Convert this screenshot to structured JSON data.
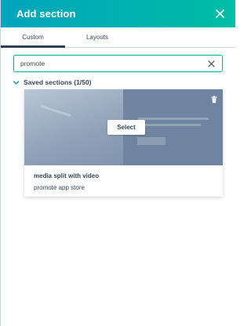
{
  "panel": {
    "title": "Add section"
  },
  "tabs": [
    {
      "label": "Custom",
      "active": true
    },
    {
      "label": "Layouts",
      "active": false
    }
  ],
  "search": {
    "value": "promote",
    "placeholder": ""
  },
  "group": {
    "label": "Saved sections (1/50)",
    "expanded": true
  },
  "card": {
    "title": "media split with video",
    "description": "promote app store",
    "select_label": "Select"
  },
  "icons": {
    "close": "close-icon",
    "clear": "clear-icon",
    "chevron": "chevron-down-icon",
    "delete": "trash-icon"
  },
  "colors": {
    "header_start": "#00a4bd",
    "header_end": "#00bda5",
    "text": "#33475b",
    "search_border": "#00bda5"
  }
}
